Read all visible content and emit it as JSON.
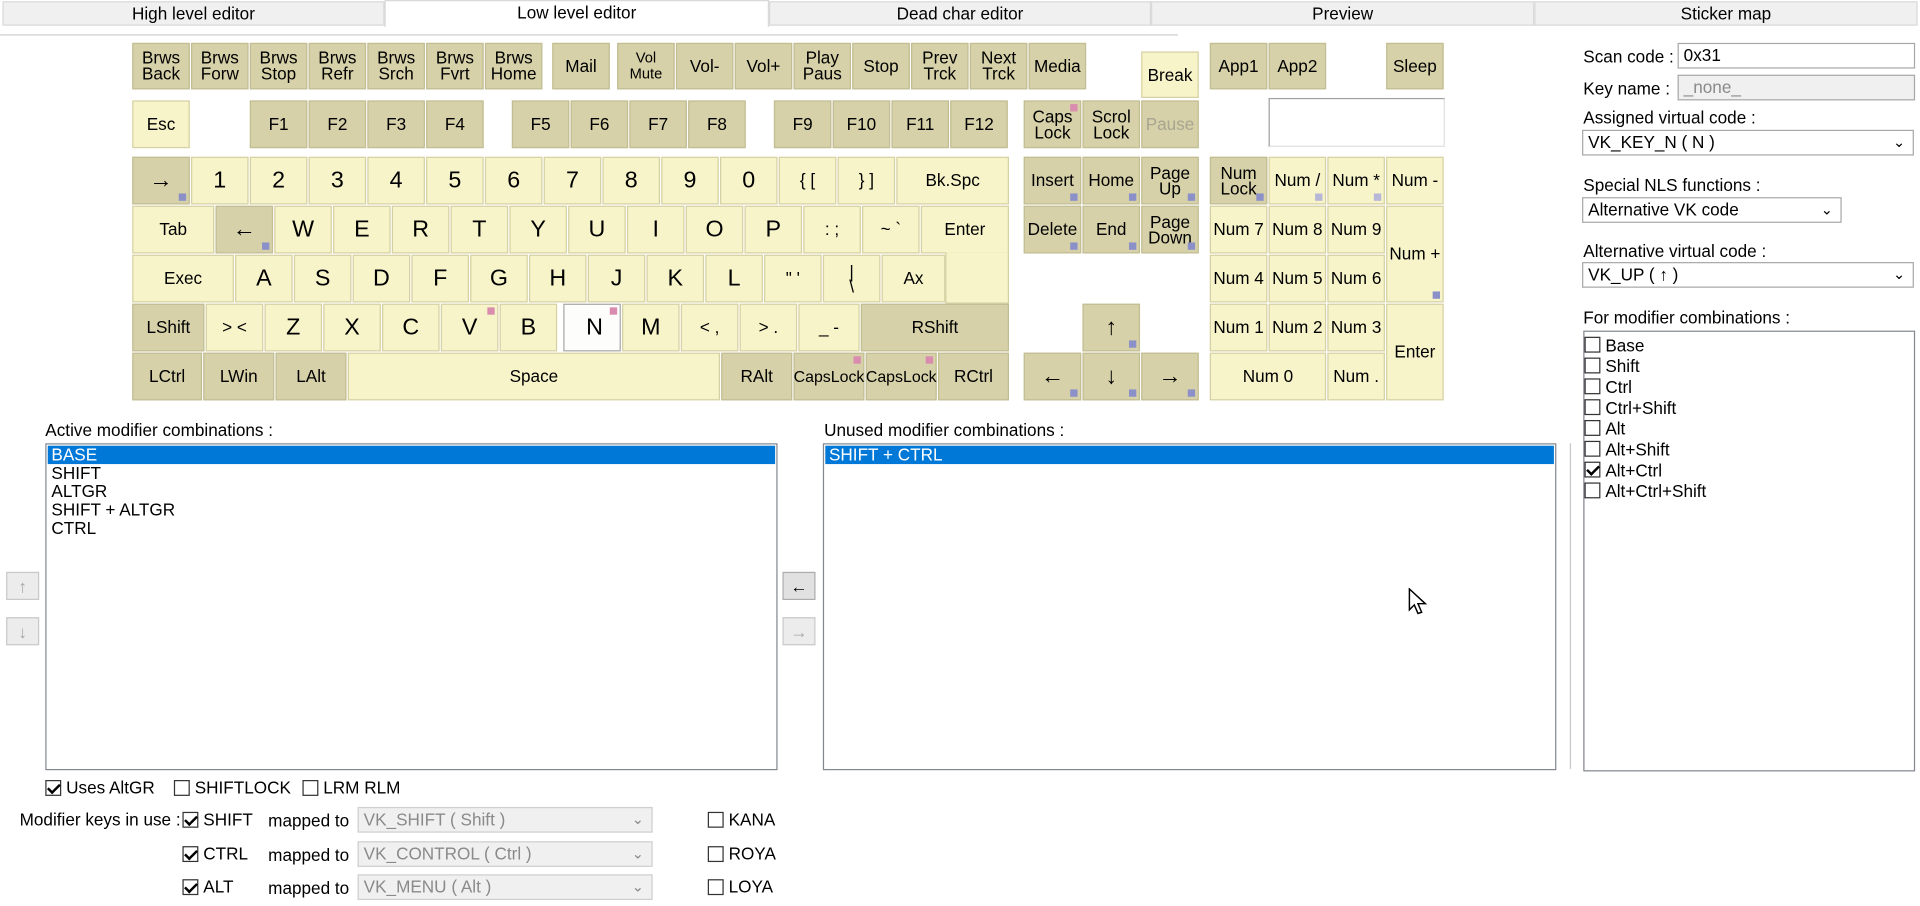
{
  "tabs": [
    {
      "label": "High level editor",
      "active": false
    },
    {
      "label": "Low level editor",
      "active": true
    },
    {
      "label": "Dead char editor",
      "active": false
    },
    {
      "label": "Preview",
      "active": false
    },
    {
      "label": "Sticker map",
      "active": false
    }
  ],
  "keys": {
    "brws_back": "Brws Back",
    "brws_forw": "Brws Forw",
    "brws_stop": "Brws Stop",
    "brws_refr": "Brws Refr",
    "brws_srch": "Brws Srch",
    "brws_fvrt": "Brws Fvrt",
    "brws_home": "Brws Home",
    "mail": "Mail",
    "vol_mute": "Vol Mute",
    "vol_down": "Vol-",
    "vol_up": "Vol+",
    "play_paus": "Play Paus",
    "stop": "Stop",
    "prev_trck": "Prev Trck",
    "next_trck": "Next Trck",
    "media": "Media",
    "break": "Break",
    "app1": "App1",
    "app2": "App2",
    "sleep": "Sleep",
    "esc": "Esc",
    "f1": "F1",
    "f2": "F2",
    "f3": "F3",
    "f4": "F4",
    "f5": "F5",
    "f6": "F6",
    "f7": "F7",
    "f8": "F8",
    "f9": "F9",
    "f10": "F10",
    "f11": "F11",
    "f12": "F12",
    "caps_lock": "Caps Lock",
    "scrol_lock": "Scrol Lock",
    "pause": "Pause",
    "arrow_right": "→",
    "n1": "1",
    "n2": "2",
    "n3": "3",
    "n4": "4",
    "n5": "5",
    "n6": "6",
    "n7": "7",
    "n8": "8",
    "n9": "9",
    "n0": "0",
    "brace_l": "{  [",
    "brace_r": "}  ]",
    "bkspc": "Bk.Spc",
    "insert": "Insert",
    "home": "Home",
    "page_up": "Page Up",
    "num_lock": "Num Lock",
    "num_div": "Num /",
    "num_mul": "Num *",
    "num_sub": "Num -",
    "tab": "Tab",
    "arrow_left": "←",
    "w": "W",
    "e": "E",
    "r": "R",
    "t": "T",
    "y": "Y",
    "u": "U",
    "i": "I",
    "o": "O",
    "p": "P",
    "colon": ":  ;",
    "tilde": "~  `",
    "enter": "Enter",
    "delete": "Delete",
    "end": "End",
    "page_down": "Page Down",
    "num7": "Num 7",
    "num8": "Num 8",
    "num9": "Num 9",
    "num_add": "Num +",
    "exec": "Exec",
    "a": "A",
    "s": "S",
    "d": "D",
    "f": "F",
    "g": "G",
    "h": "H",
    "j": "J",
    "k": "K",
    "l": "L",
    "quote": "\"  '",
    "pipe": "|\n\\",
    "ax": "Ax",
    "num4": "Num 4",
    "num5": "Num 5",
    "num6": "Num 6",
    "lshift": "LShift",
    "gt": ">  <",
    "z": "Z",
    "x": "X",
    "c": "C",
    "v": "V",
    "b": "B",
    "n": "N",
    "m": "M",
    "comma": "<  ,",
    "period": ">  .",
    "under": "_  -",
    "rshift": "RShift",
    "up": "↑",
    "num1": "Num 1",
    "num2": "Num 2",
    "num3": "Num 3",
    "num_enter": "Enter",
    "lctrl": "LCtrl",
    "lwin": "LWin",
    "lalt": "LAlt",
    "space": "Space",
    "ralt": "RAlt",
    "capslock1": "CapsLock",
    "capslock2": "CapsLock",
    "rctrl": "RCtrl",
    "left": "←",
    "down": "↓",
    "right": "→",
    "num0": "Num 0",
    "num_dot": "Num ."
  },
  "right_panel": {
    "scan_code_label": "Scan code :",
    "scan_code_value": "0x31",
    "key_name_label": "Key name :",
    "key_name_value": "_none_",
    "assigned_vk_label": "Assigned virtual code :",
    "assigned_vk_value": "VK_KEY_N ( N )",
    "nls_label": "Special NLS functions :",
    "nls_value": "Alternative VK code",
    "alt_vk_label": "Alternative virtual code :",
    "alt_vk_value": "VK_UP ( ↑ )",
    "modifier_combos_label": "For modifier combinations :",
    "modifier_combos": [
      {
        "label": "Base",
        "checked": false
      },
      {
        "label": "Shift",
        "checked": false
      },
      {
        "label": "Ctrl",
        "checked": false
      },
      {
        "label": "Ctrl+Shift",
        "checked": false
      },
      {
        "label": "Alt",
        "checked": false
      },
      {
        "label": "Alt+Shift",
        "checked": false
      },
      {
        "label": "Alt+Ctrl",
        "checked": true
      },
      {
        "label": "Alt+Ctrl+Shift",
        "checked": false
      }
    ]
  },
  "active_mods": {
    "label": "Active modifier combinations :",
    "items": [
      "BASE",
      "SHIFT",
      "ALTGR",
      "SHIFT + ALTGR",
      "CTRL"
    ],
    "selected": 0
  },
  "unused_mods": {
    "label": "Unused modifier combinations :",
    "items": [
      "SHIFT + CTRL"
    ],
    "selected": 0
  },
  "buttons": {
    "up": "↑",
    "down": "↓",
    "move_left": "←",
    "move_right": "→"
  },
  "options": {
    "uses_altgr": {
      "label": "Uses AltGR",
      "checked": true
    },
    "shiftlock": {
      "label": "SHIFTLOCK",
      "checked": false
    },
    "lrm_rlm": {
      "label": "LRM RLM",
      "checked": false
    }
  },
  "modifier_keys": {
    "label": "Modifier keys in use :",
    "mapped_label": "mapped to",
    "rows": [
      {
        "name": "SHIFT",
        "checked": true,
        "mapped": "VK_SHIFT ( Shift )"
      },
      {
        "name": "CTRL",
        "checked": true,
        "mapped": "VK_CONTROL ( Ctrl )"
      },
      {
        "name": "ALT",
        "checked": true,
        "mapped": "VK_MENU ( Alt )"
      }
    ],
    "extra": [
      {
        "name": "KANA",
        "checked": false
      },
      {
        "name": "ROYA",
        "checked": false
      },
      {
        "name": "LOYA",
        "checked": false
      }
    ]
  }
}
